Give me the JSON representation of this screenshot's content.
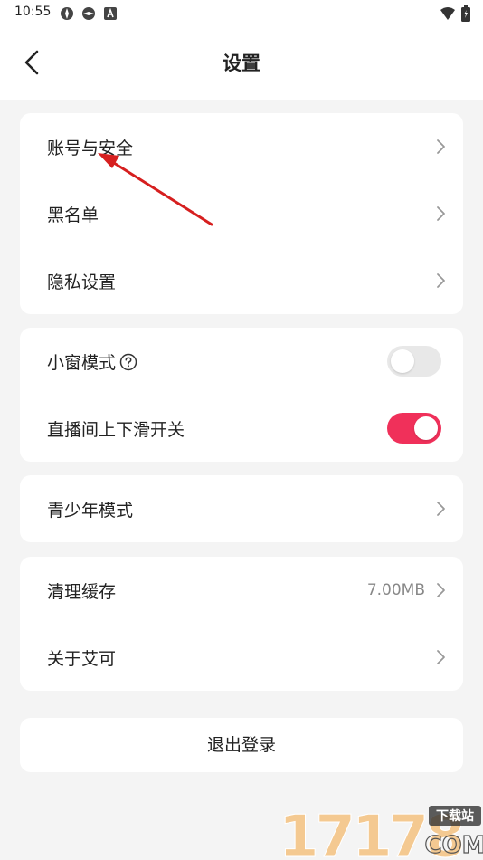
{
  "status_bar": {
    "time": "10:55"
  },
  "header": {
    "title": "设置"
  },
  "groups": {
    "account": [
      {
        "label": "账号与安全"
      },
      {
        "label": "黑名单"
      },
      {
        "label": "隐私设置"
      }
    ],
    "toggles": [
      {
        "label": "小窗模式",
        "state": "off"
      },
      {
        "label": "直播间上下滑开关",
        "state": "on"
      }
    ],
    "youth": {
      "label": "青少年模式"
    },
    "misc": [
      {
        "label": "清理缓存",
        "value": "7.00MB"
      },
      {
        "label": "关于艾可"
      }
    ]
  },
  "logout_label": "退出登录",
  "watermark": {
    "digits": "17178",
    "tag": "下载站",
    "domain": "COM"
  },
  "colors": {
    "accent": "#f0305a",
    "background": "#f4f4f4",
    "card": "#ffffff",
    "annotation_arrow": "#d61f1f"
  }
}
